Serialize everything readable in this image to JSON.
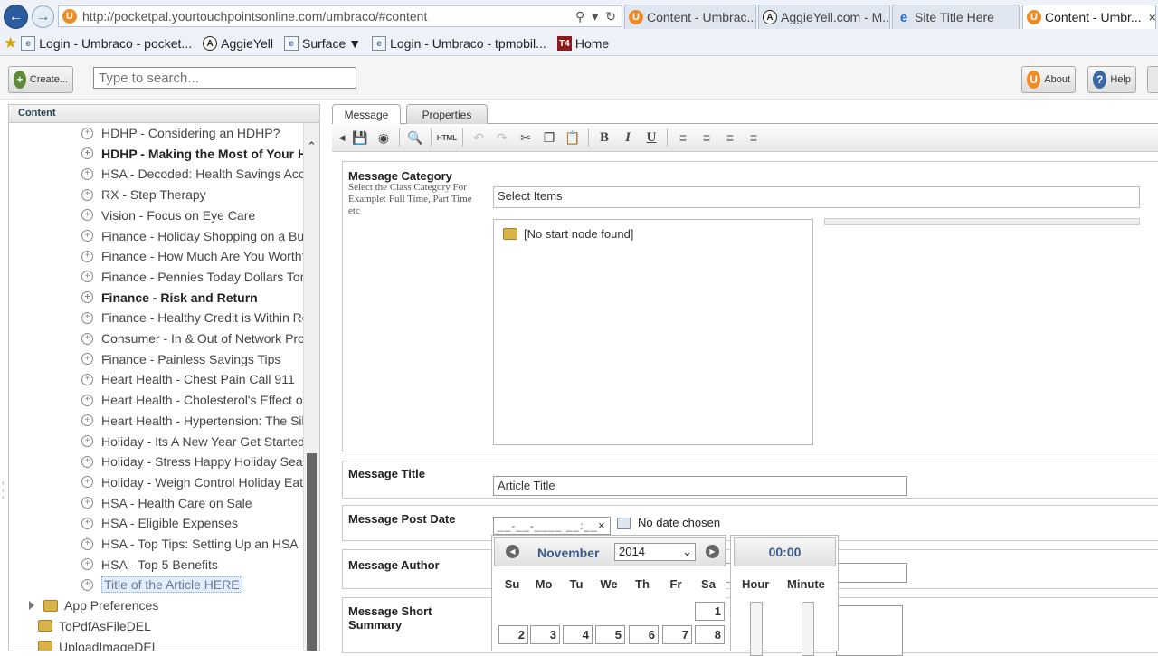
{
  "browser": {
    "url": "http://pocketpal.yourtouchpointsonline.com/umbraco/#content",
    "tabs": [
      {
        "label": "Content - Umbrac...",
        "icon": "umbraco-icon"
      },
      {
        "label": "AggieYell.com - M...",
        "icon": "aggieyell-icon"
      },
      {
        "label": "Site Title Here",
        "icon": "ie-page-icon"
      },
      {
        "label": "Content - Umbr...",
        "icon": "umbraco-icon",
        "active": true
      }
    ],
    "favorites": [
      {
        "label": "Login - Umbraco - pocket..."
      },
      {
        "label": "AggieYell"
      },
      {
        "label": "Surface"
      },
      {
        "label": "Login - Umbraco - tpmobil..."
      },
      {
        "label": "Home"
      }
    ]
  },
  "toolbar": {
    "create_label": "Create...",
    "search_placeholder": "Type to search...",
    "about_label": "About",
    "help_label": "Help"
  },
  "tree": {
    "header": "Content",
    "items": [
      {
        "label": "HDHP - Considering an HDHP?"
      },
      {
        "label": "HDHP - Making the Most of Your HDHP",
        "bold": true
      },
      {
        "label": "HSA - Decoded: Health Savings Accounts"
      },
      {
        "label": "RX - Step Therapy"
      },
      {
        "label": "Vision - Focus on Eye Care"
      },
      {
        "label": "Finance - Holiday Shopping on a Budget"
      },
      {
        "label": "Finance - How Much Are You Worth?"
      },
      {
        "label": "Finance - Pennies Today Dollars Tomorrow"
      },
      {
        "label": "Finance - Risk and Return",
        "bold": true
      },
      {
        "label": "Finance - Healthy Credit is Within Reach"
      },
      {
        "label": "Consumer - In & Out of Network Providers"
      },
      {
        "label": "Finance - Painless Savings Tips"
      },
      {
        "label": "Heart Health - Chest Pain Call 911"
      },
      {
        "label": "Heart Health - Cholesterol's Effect on"
      },
      {
        "label": "Heart Health - Hypertension: The Silent"
      },
      {
        "label": "Holiday - Its A New Year Get Started"
      },
      {
        "label": "Holiday - Stress Happy Holiday Season"
      },
      {
        "label": "Holiday - Weigh Control Holiday Eating"
      },
      {
        "label": "HSA - Health Care on Sale"
      },
      {
        "label": "HSA - Eligible Expenses"
      },
      {
        "label": "HSA - Top Tips: Setting Up an HSA"
      },
      {
        "label": "HSA - Top 5 Benefits"
      },
      {
        "label": "Title of the Article HERE",
        "selected": true
      }
    ],
    "folders": [
      {
        "label": "App Preferences",
        "expandable": true
      },
      {
        "label": "ToPdfAsFileDEL"
      },
      {
        "label": "UploadImageDEL"
      }
    ]
  },
  "editor": {
    "tabs": [
      "Message",
      "Properties"
    ],
    "fields": {
      "category": {
        "label": "Message Category",
        "description": "Select the Class Category For Example: Full Time, Part Time etc",
        "select_text": "Select Items",
        "tree_text": "[No start node found]"
      },
      "title": {
        "label": "Message Title",
        "value": "Article Title"
      },
      "post_date": {
        "label": "Message Post Date",
        "value": "__-__-____ __:__",
        "clear": "×",
        "status": "No date chosen"
      },
      "author": {
        "label": "Message Author"
      },
      "summary": {
        "label": "Message Short Summary"
      }
    }
  },
  "datepicker": {
    "month": "November",
    "year": "2014",
    "days_of_week": [
      "Su",
      "Mo",
      "Tu",
      "We",
      "Th",
      "Fr",
      "Sa"
    ],
    "week1": [
      "1"
    ],
    "week2": [
      "2",
      "3",
      "4",
      "5",
      "6",
      "7",
      "8"
    ],
    "time": "00:00",
    "hour_label": "Hour",
    "minute_label": "Minute"
  }
}
